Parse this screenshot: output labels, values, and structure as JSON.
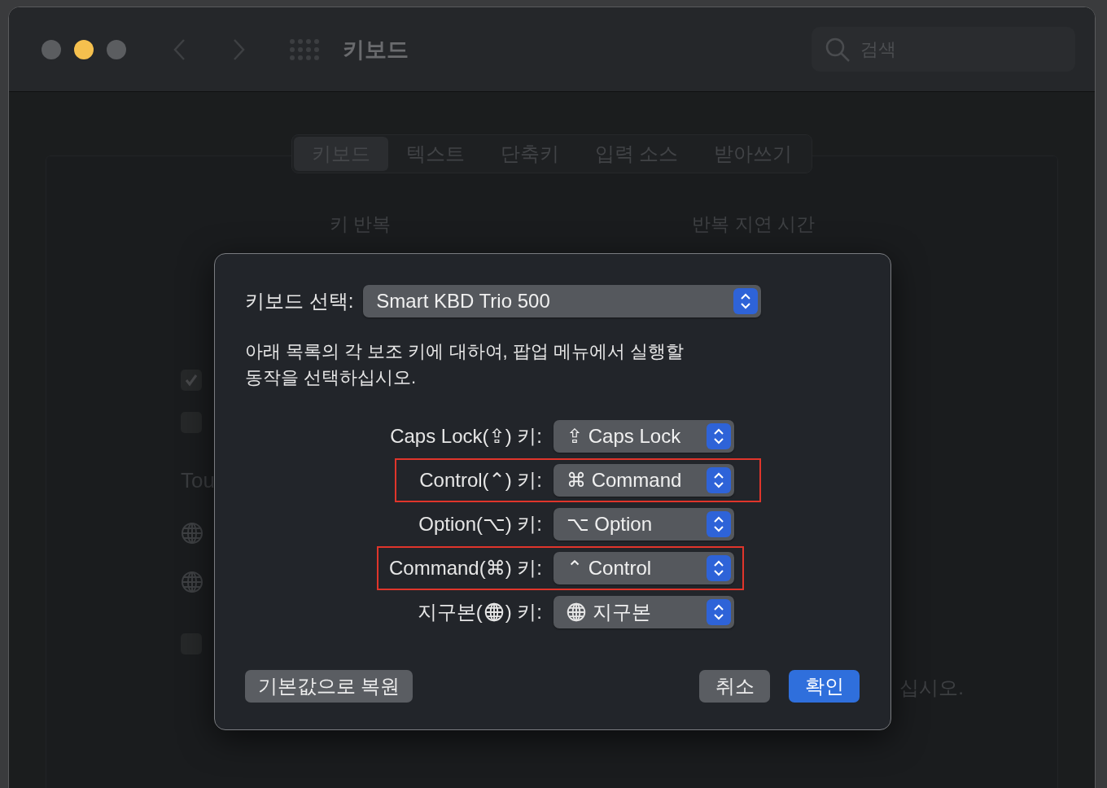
{
  "window": {
    "title": "키보드",
    "search": {
      "placeholder": "검색"
    }
  },
  "tabs": [
    {
      "label": "키보드",
      "selected": true
    },
    {
      "label": "텍스트",
      "selected": false
    },
    {
      "label": "단축키",
      "selected": false
    },
    {
      "label": "입력 소스",
      "selected": false
    },
    {
      "label": "받아쓰기",
      "selected": false
    }
  ],
  "background": {
    "headings": [
      "키 반복",
      "반복 지연 시간"
    ],
    "items": [
      {
        "kind": "checkbox",
        "checked": true
      },
      {
        "kind": "checkbox",
        "checked": false
      },
      {
        "kind": "heading",
        "label": "Tou"
      },
      {
        "kind": "globe"
      },
      {
        "kind": "globe"
      },
      {
        "kind": "checkbox",
        "checked": false
      }
    ],
    "note": "십시오."
  },
  "dialog": {
    "keyboard_label": "키보드 선택:",
    "keyboard_value": "Smart KBD Trio 500",
    "description": "아래 목록의 각 보조 키에 대하여, 팝업 메뉴에서 실행할\n동작을 선택하십시오.",
    "rows": [
      {
        "kind": "symbol",
        "label": "Caps Lock(⇪) 키:",
        "value": "⇪ Caps Lock",
        "highlighted": false
      },
      {
        "kind": "symbol",
        "label": "Control(⌃) 키:",
        "value": "⌘ Command",
        "highlighted": true
      },
      {
        "kind": "symbol",
        "label": "Option(⌥) 키:",
        "value": "⌥ Option",
        "highlighted": false
      },
      {
        "kind": "symbol",
        "label": "Command(⌘) 키:",
        "value": "⌃ Control",
        "highlighted": true
      },
      {
        "kind": "globe",
        "label_start": "지구본(",
        "label_end": ") 키:",
        "value": "지구본",
        "highlighted": false
      }
    ],
    "buttons": [
      {
        "label": "기본값으로 복원",
        "kind": "secondary"
      },
      {
        "label": "취소",
        "kind": "secondary"
      },
      {
        "label": "확인",
        "kind": "primary"
      }
    ]
  }
}
